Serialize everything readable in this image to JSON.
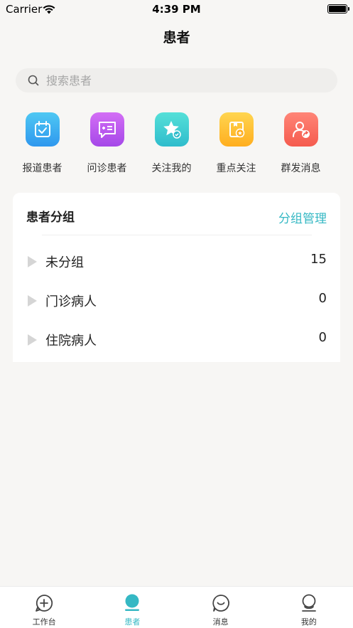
{
  "status_bar": {
    "carrier": "Carrier",
    "time": "4:39 PM"
  },
  "nav": {
    "title": "患者"
  },
  "search": {
    "placeholder": "搜索患者"
  },
  "actions": [
    {
      "label": "报道患者",
      "icon": "calendar-check-icon",
      "color_top": "#4fc8f3",
      "color_bottom": "#2f98ee"
    },
    {
      "label": "问诊患者",
      "icon": "chat-bubble-icon",
      "color_top": "#d36ef5",
      "color_bottom": "#a548e8"
    },
    {
      "label": "关注我的",
      "icon": "star-badge-icon",
      "color_top": "#55e0d8",
      "color_bottom": "#2fbccc"
    },
    {
      "label": "重点关注",
      "icon": "bookmark-star-icon",
      "color_top": "#ffd550",
      "color_bottom": "#ffae1f"
    },
    {
      "label": "群发消息",
      "icon": "user-share-icon",
      "color_top": "#ff8577",
      "color_bottom": "#f55b4e"
    }
  ],
  "groups": {
    "title": "患者分组",
    "manage_label": "分组管理",
    "items": [
      {
        "name": "未分组",
        "count": "15"
      },
      {
        "name": "门诊病人",
        "count": "0"
      },
      {
        "name": "住院病人",
        "count": "0"
      }
    ]
  },
  "tabbar": {
    "items": [
      {
        "label": "工作台",
        "icon": "plus-bubble-icon",
        "active": false
      },
      {
        "label": "患者",
        "icon": "patient-icon",
        "active": true
      },
      {
        "label": "消息",
        "icon": "message-icon",
        "active": false
      },
      {
        "label": "我的",
        "icon": "profile-icon",
        "active": false
      }
    ]
  },
  "colors": {
    "accent": "#35b8c4",
    "background": "#f7f6f4"
  }
}
